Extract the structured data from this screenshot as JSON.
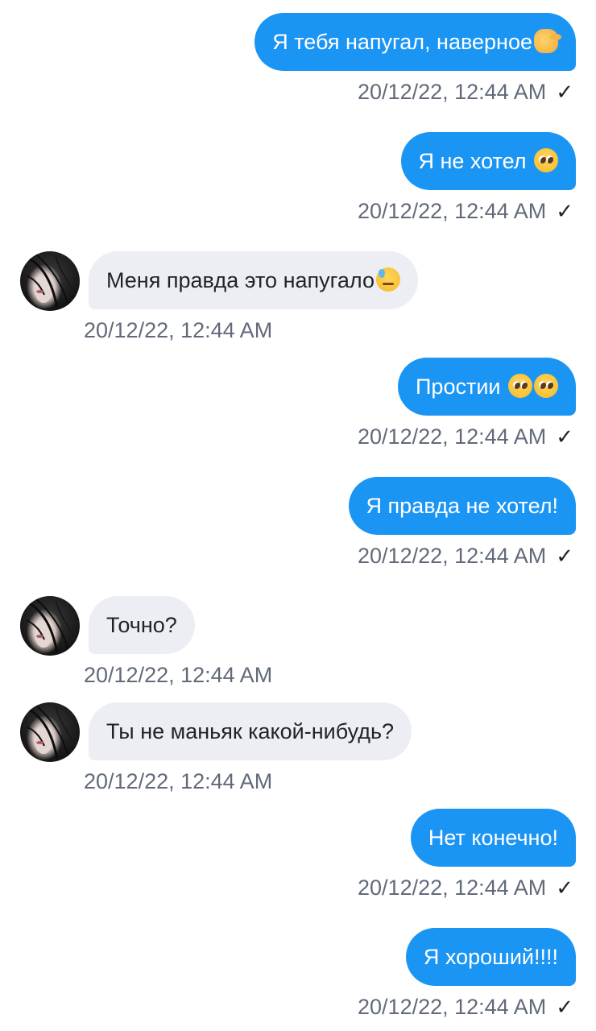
{
  "messages": [
    {
      "direction": "out",
      "text": "Я тебя напугал, наверное",
      "emoji": [
        "pinching-hand-emoji"
      ],
      "time": "20/12/22, 12:44 AM",
      "read_mark": "✓"
    },
    {
      "direction": "out",
      "text": "Я не хотел ",
      "emoji": [
        "pleading-face-emoji"
      ],
      "time": "20/12/22, 12:44 AM",
      "read_mark": "✓"
    },
    {
      "direction": "in",
      "text": "Меня правда это напугало",
      "emoji": [
        "downcast-sweat-face-emoji"
      ],
      "time": "20/12/22, 12:44 AM"
    },
    {
      "direction": "out",
      "text": "Простии ",
      "emoji": [
        "pleading-face-emoji",
        "pleading-face-emoji"
      ],
      "time": "20/12/22, 12:44 AM",
      "read_mark": "✓"
    },
    {
      "direction": "out",
      "text": "Я правда не хотел!",
      "emoji": [],
      "time": "20/12/22, 12:44 AM",
      "read_mark": "✓"
    },
    {
      "direction": "in",
      "text": "Точно?",
      "emoji": [],
      "time": "20/12/22, 12:44 AM"
    },
    {
      "direction": "in",
      "text": "Ты не маньяк какой-нибудь?",
      "emoji": [],
      "time": "20/12/22, 12:44 AM"
    },
    {
      "direction": "out",
      "text": "Нет конечно!",
      "emoji": [],
      "time": "20/12/22, 12:44 AM",
      "read_mark": "✓"
    },
    {
      "direction": "out",
      "text": "Я хороший!!!!",
      "emoji": [],
      "time": "20/12/22, 12:44 AM",
      "read_mark": "✓"
    }
  ],
  "colors": {
    "outgoing_bubble": "#1b95f3",
    "incoming_bubble": "#eceef3",
    "timestamp": "#626a7a"
  }
}
